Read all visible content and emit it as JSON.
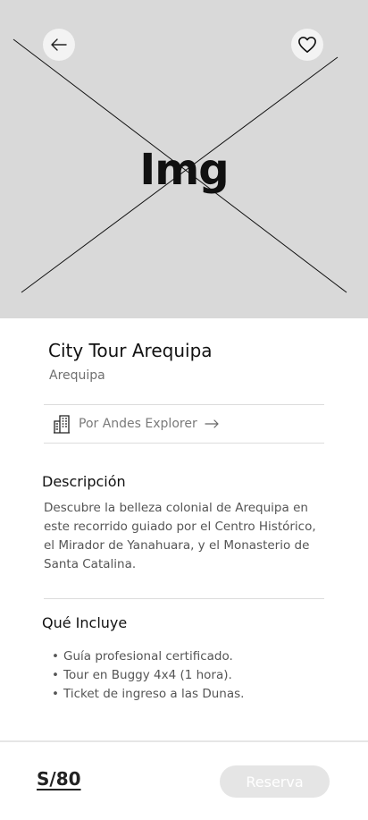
{
  "hero": {
    "placeholder_label": "Img"
  },
  "tour": {
    "title": "City Tour Arequipa",
    "location": "Arequipa",
    "operator_label": "Por Andes Explorer"
  },
  "description": {
    "heading": "Descripción",
    "text": "Descubre la belleza colonial de Arequipa en este recorrido guiado por el Centro Histórico, el Mirador de Yanahuara, y el Monasterio de Santa Catalina."
  },
  "includes": {
    "heading": "Qué Incluye",
    "items": [
      "Guía profesional certificado.",
      "Tour en Buggy 4x4 (1 hora).",
      "Ticket de ingreso a las Dunas."
    ]
  },
  "footer": {
    "price": "S/80",
    "reserve_label": "Reserva"
  },
  "icons": {
    "back": "arrow-left-icon",
    "favorite": "heart-icon",
    "operator": "building-icon",
    "operator_link": "arrow-right-icon"
  },
  "colors": {
    "hero_background": "#d9d9d9",
    "reserve_button_disabled": "#e5e5e5"
  }
}
